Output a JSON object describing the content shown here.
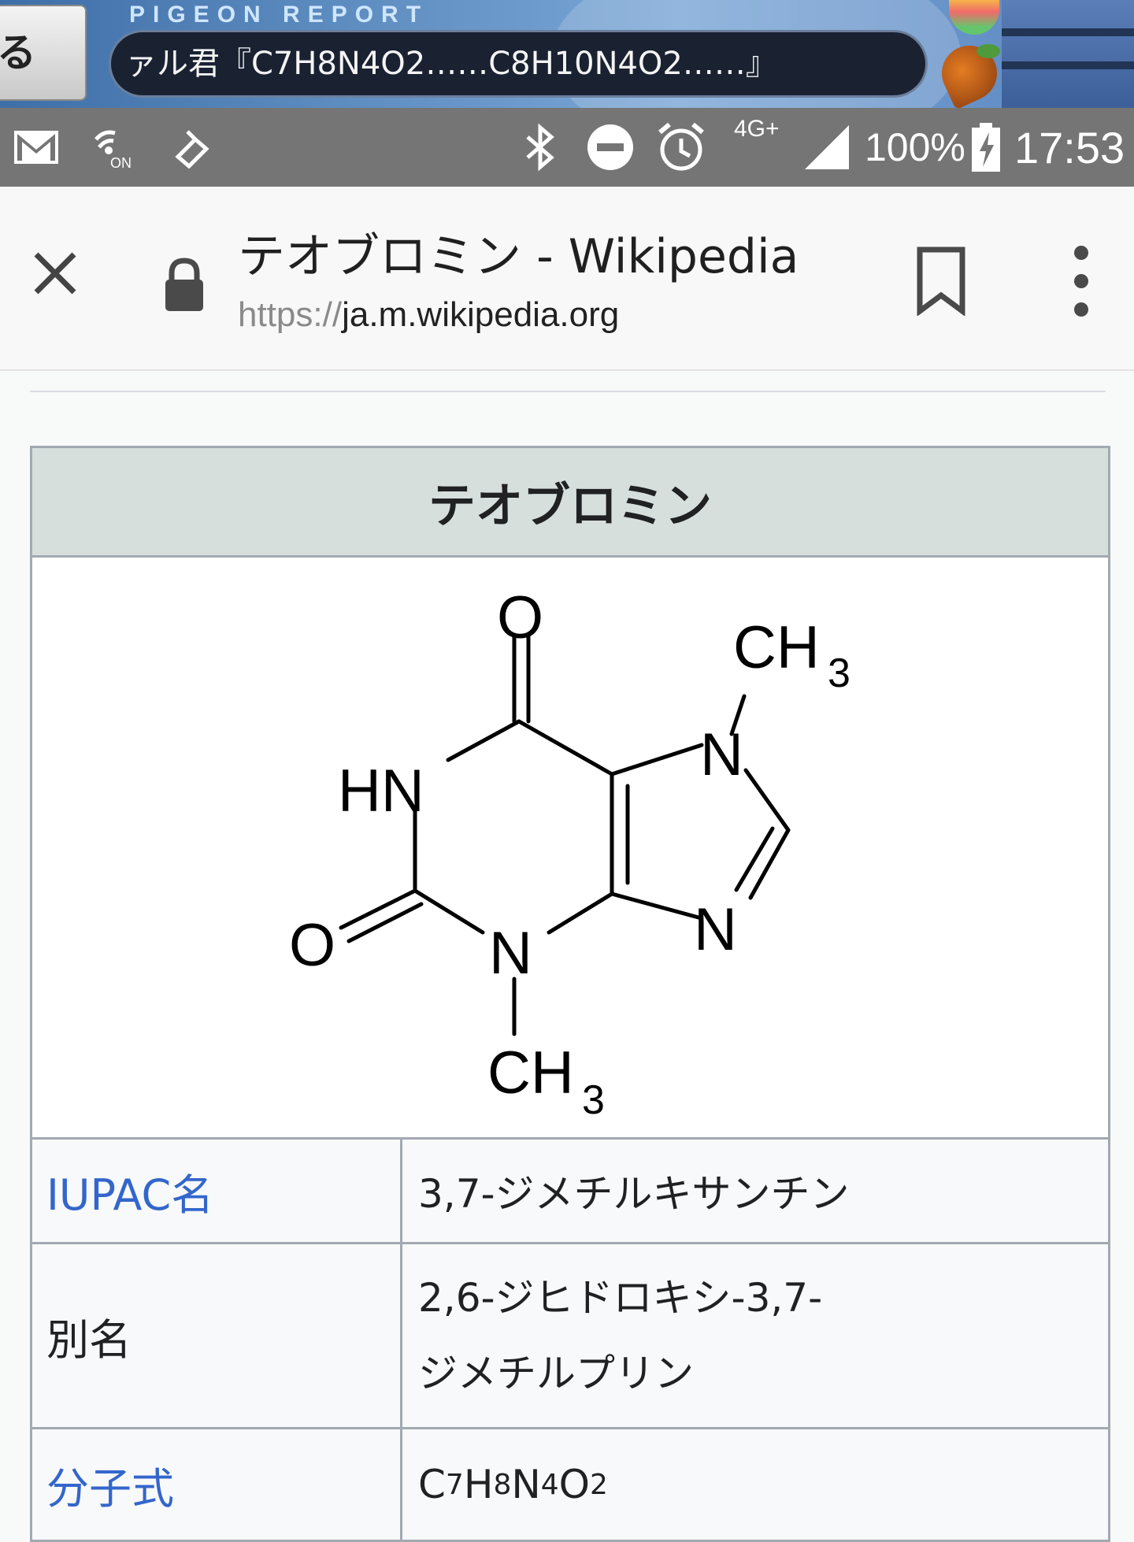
{
  "banner": {
    "back_label": "る",
    "title": "PIGEON REPORT",
    "ticker": "ァル君『C7H8N4O2……C8H10N4O2……』"
  },
  "status_bar": {
    "network": "4G+",
    "battery": "100%",
    "time": "17:53",
    "icons": [
      "gmail-icon",
      "nfc-on-icon",
      "touch-icon",
      "bluetooth-icon",
      "do-not-disturb-icon",
      "alarm-icon",
      "signal-icon",
      "battery-charging-icon"
    ]
  },
  "toolbar": {
    "title": "テオブロミン - Wikipedia",
    "url_scheme": "https://",
    "url_host": "ja.m.wikipedia.org",
    "icons": [
      "close-icon",
      "lock-icon",
      "bookmark-icon",
      "more-vert-icon"
    ]
  },
  "infobox": {
    "title": "テオブロミン",
    "structure_labels": {
      "o_top": "O",
      "hn": "HN",
      "n7": "N",
      "ch3_top": "CH",
      "ch3_top_sub": "3",
      "n9": "N",
      "o_left": "O",
      "n3": "N",
      "ch3_bottom": "CH",
      "ch3_bottom_sub": "3"
    },
    "rows": [
      {
        "label": "IUPAC名",
        "value": "3,7-ジメチルキサンチン",
        "label_is_link": true
      },
      {
        "label": "別名",
        "value_line1": "2,6-ジヒドロキシ-3,7-",
        "value_line2": "ジメチルプリン",
        "label_is_link": false
      },
      {
        "label": "分子式",
        "label_is_link": true,
        "formula": {
          "c": "C",
          "c_n": "7",
          "h": "H",
          "h_n": "8",
          "n": "N",
          "n_n": "4",
          "o": "O",
          "o_n": "2"
        }
      }
    ]
  },
  "colors": {
    "status_bar": "#757575",
    "link": "#3366cc",
    "infobox_header": "#d7dfdd",
    "infobox_border": "#a2a9b1"
  }
}
